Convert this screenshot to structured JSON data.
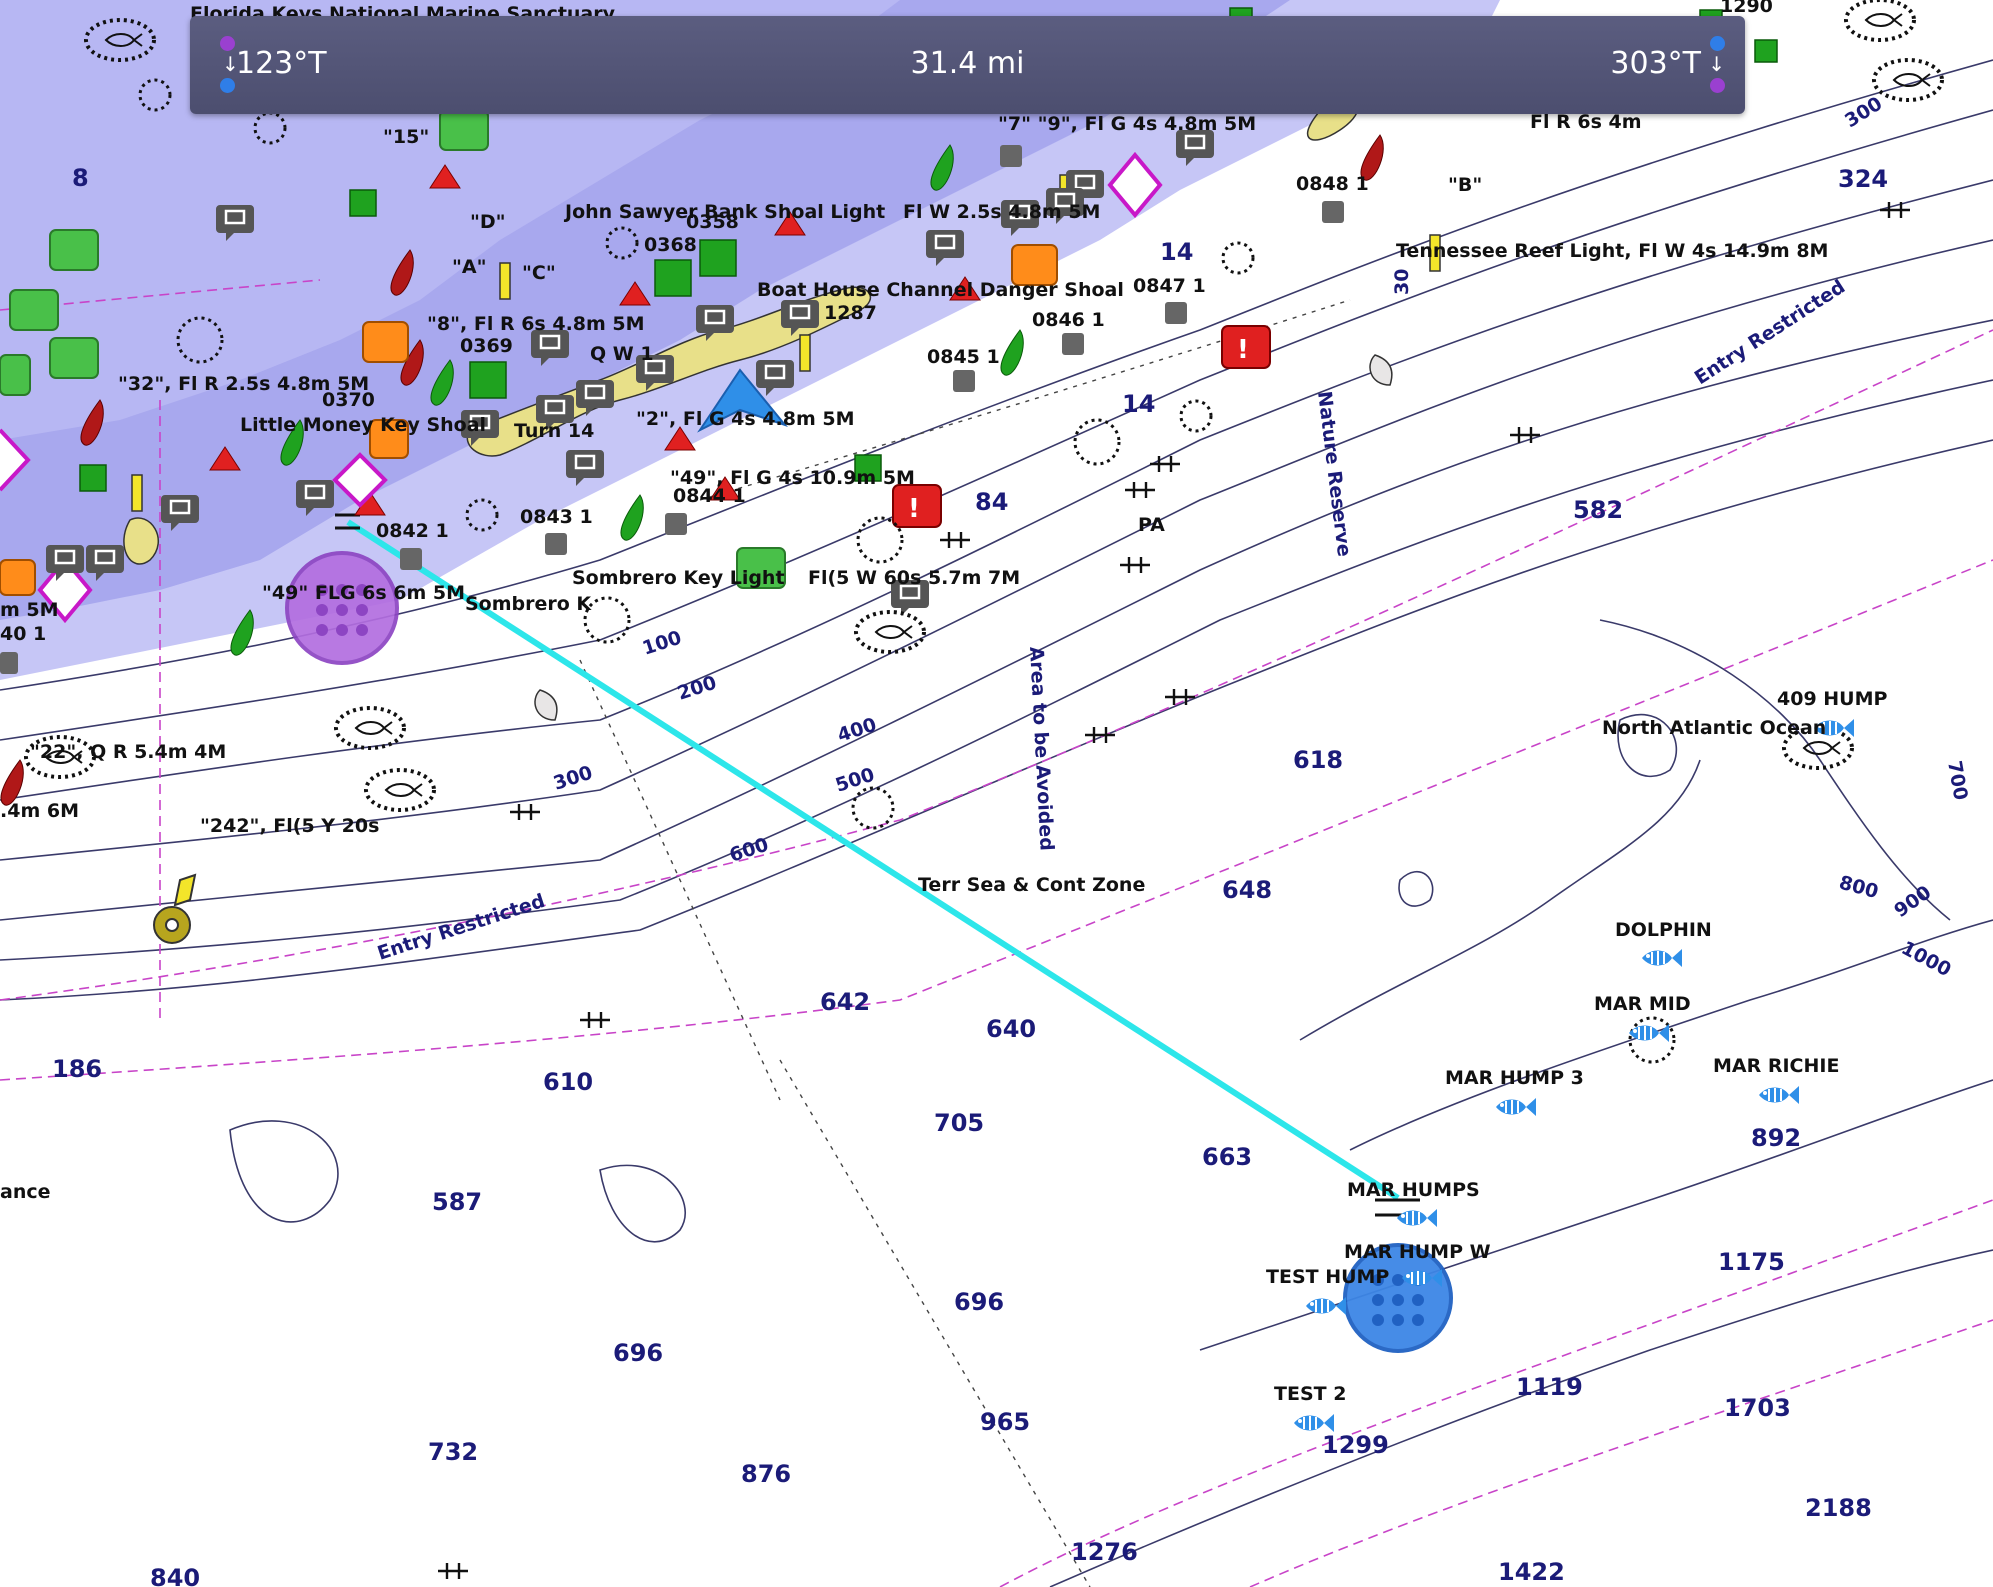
{
  "measure_bar": {
    "start_bearing": "123°T",
    "distance": "31.4 mi",
    "end_bearing": "303°T",
    "start_icon": "down-arrow-icon",
    "end_icon": "down-arrow-icon"
  },
  "colors": {
    "shallow_water": "#c6c6f6",
    "shoal_water": "#a8a8ee",
    "land": "#e8e089",
    "deep_water": "#ffffff",
    "route_line": "#2de6ea",
    "depth_text": "#1b1b78",
    "restricted_line": "#c844c8",
    "fish_waypoint": "#2f8fe8",
    "start_marker": "#b36ee0",
    "end_marker": "#3d86e6"
  },
  "map": {
    "feature_labels": [
      "Florida Keys National Marine Sanctuary",
      "John Sawyer Bank Shoal Light",
      "Fl W 2.5s 4.8m 5M",
      "Boat House Channel Danger Shoal",
      "\"32\",  Fl R 2.5s 4.8m 5M",
      "Little Money Key Shoal",
      "\"8\",  Fl R 6s 4.8m 5M",
      "Q W 1",
      "\"2\",  Fl G 4s 4.8m 5M",
      "Turn 14",
      "\"49\",  Fl G 4s 10.9m 5M",
      "Sombrero Key Light",
      "Fl(5 W 60s 5.7m 7M",
      "\"49\" FLG 6s 6m 5M",
      "Sombrero K",
      "\"22\",  Q R 5.4m 4M",
      "\"242\",  Fl(5 Y 20s",
      "Tennessee Reef Light,  Fl W 4s 14.9m 8M",
      "\"7\"  \"9\",  Fl G 4s 4.8m 5M",
      "Fl R 6s 4m",
      "Terr Sea & Cont Zone",
      "North Atlantic Ocean",
      "PA",
      "\"15\"",
      "\"D\"",
      "\"A\"",
      "\"C\"",
      "\"B\"",
      "0358",
      "0368",
      "0369",
      "0370",
      "0842 1",
      "0843 1",
      "0844 1",
      "0845 1",
      "0846 1",
      "0847 1",
      "0848 1",
      "1287",
      "1290",
      "ance",
      "m 5M",
      "40 1",
      ".4m 6M"
    ],
    "zone_labels": [
      "Entry Restricted",
      "Entry Restricted",
      "Nature Reserve",
      "Area to be Avoided"
    ],
    "contour_labels": [
      "100",
      "200",
      "300",
      "400",
      "500",
      "600",
      "700",
      "800",
      "900",
      "1000",
      "300",
      "30"
    ],
    "depth_soundings": [
      "8",
      "14",
      "14",
      "84",
      "324",
      "582",
      "618",
      "648",
      "642",
      "640",
      "610",
      "186",
      "587",
      "705",
      "663",
      "696",
      "696",
      "732",
      "876",
      "965",
      "840",
      "1276",
      "1299",
      "1119",
      "1175",
      "1703",
      "2188",
      "1422",
      "892"
    ],
    "fish_waypoints": [
      "409 HUMP",
      "DOLPHIN",
      "MAR MID",
      "MAR HUMP 3",
      "MAR RICHIE",
      "MAR HUMPS",
      "MAR HUMP W",
      "TEST HUMP",
      "TEST 2"
    ],
    "route": {
      "start_marker": "route-start-handle",
      "end_marker": "route-end-handle"
    }
  }
}
